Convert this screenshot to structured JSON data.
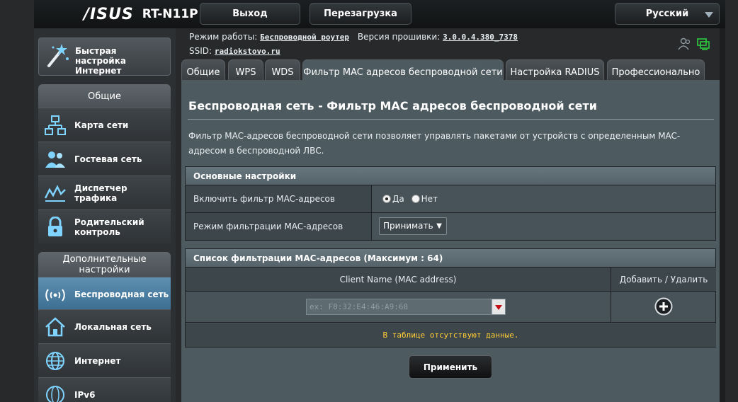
{
  "header": {
    "brand": "/ISUS",
    "model": "RT-N11P",
    "logout_label": "Выход",
    "reboot_label": "Перезагрузка",
    "language": "Русский"
  },
  "status": {
    "mode_label": "Режим работы:",
    "mode_value": "Беспроводной роутер",
    "firmware_label": "Версия прошивки:",
    "firmware_value": "3.0.0.4.380_7378",
    "ssid_label": "SSID:",
    "ssid_value": "radiokstovo.ru"
  },
  "sidebar": {
    "quick_setup": "Быстрая настройка Интернет",
    "general_head": "Общие",
    "general_items": [
      {
        "label": "Карта сети",
        "icon": "network-map-icon"
      },
      {
        "label": "Гостевая сеть",
        "icon": "guest-network-icon"
      },
      {
        "label": "Диспетчер трафика",
        "icon": "traffic-manager-icon"
      },
      {
        "label": "Родительский контроль",
        "icon": "parental-lock-icon"
      }
    ],
    "advanced_head": "Дополнительные настройки",
    "advanced_items": [
      {
        "label": "Беспроводная сеть",
        "icon": "wifi-icon",
        "active": true
      },
      {
        "label": "Локальная сеть",
        "icon": "home-icon"
      },
      {
        "label": "Интернет",
        "icon": "globe-icon"
      },
      {
        "label": "IPv6",
        "icon": "ipv6-icon"
      }
    ]
  },
  "tabs": [
    {
      "label": "Общие"
    },
    {
      "label": "WPS"
    },
    {
      "label": "WDS"
    },
    {
      "label": "Фильтр MAC адресов беспроводной сети",
      "active": true
    },
    {
      "label": "Настройка RADIUS"
    },
    {
      "label": "Профессионально"
    }
  ],
  "main": {
    "title": "Беспроводная сеть - Фильтр MAC адресов беспроводной сети",
    "description": "Фильтр MAC-адресов беспроводной сети позволяет управлять пакетами от устройств с определенным MAC-адресом в беспроводной ЛВС.",
    "basic_section": {
      "title": "Основные настройки",
      "enable_label": "Включить фильтр MAC-адресов",
      "enable_yes": "Да",
      "enable_no": "Нет",
      "enable_value": "yes",
      "mode_label": "Режим фильтрации MAC-адресов",
      "mode_value": "Принимать"
    },
    "list_section": {
      "title": "Список фильтрации MAC-адресов (Максимум : 64)",
      "col_name": "Client Name (MAC address)",
      "col_action": "Добавить / Удалить",
      "input_placeholder": "ex: F8:32:E4:46:A9:68",
      "empty_text": "В таблице отсутствуют данные."
    },
    "apply_label": "Применить"
  },
  "colors": {
    "background": "#27292b",
    "panel": "#4d5a60",
    "active_menu": "#4a7ea2",
    "warning_text": "#ffcc33",
    "status_green": "#2ecc40"
  }
}
